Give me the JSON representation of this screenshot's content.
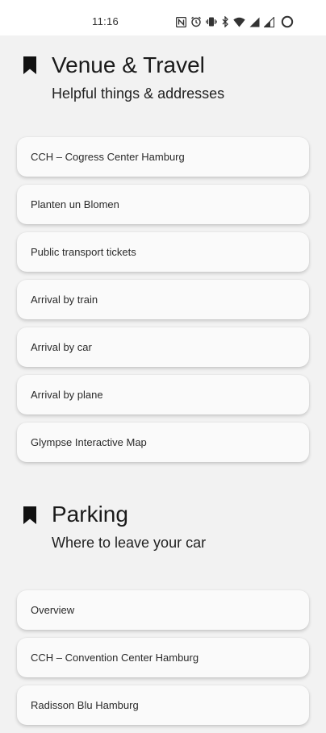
{
  "status_bar": {
    "time": "11:16",
    "icons": [
      "nfc-icon",
      "alarm-icon",
      "vibrate-icon",
      "bluetooth-icon",
      "wifi-icon",
      "signal-icon",
      "signal-icon",
      "battery-icon"
    ]
  },
  "venue_section": {
    "title": "Venue & Travel",
    "subtitle": "Helpful things & addresses",
    "items": [
      {
        "label": "CCH – Cogress Center Hamburg"
      },
      {
        "label": "Planten un Blomen"
      },
      {
        "label": "Public transport tickets"
      },
      {
        "label": "Arrival by train"
      },
      {
        "label": "Arrival by car"
      },
      {
        "label": "Arrival by plane"
      },
      {
        "label": "Glympse Interactive Map"
      }
    ]
  },
  "parking_section": {
    "title": "Parking",
    "subtitle": "Where to leave your car",
    "items": [
      {
        "label": "Overview"
      },
      {
        "label": "CCH – Convention Center Hamburg"
      },
      {
        "label": "Radisson Blu Hamburg"
      }
    ]
  }
}
